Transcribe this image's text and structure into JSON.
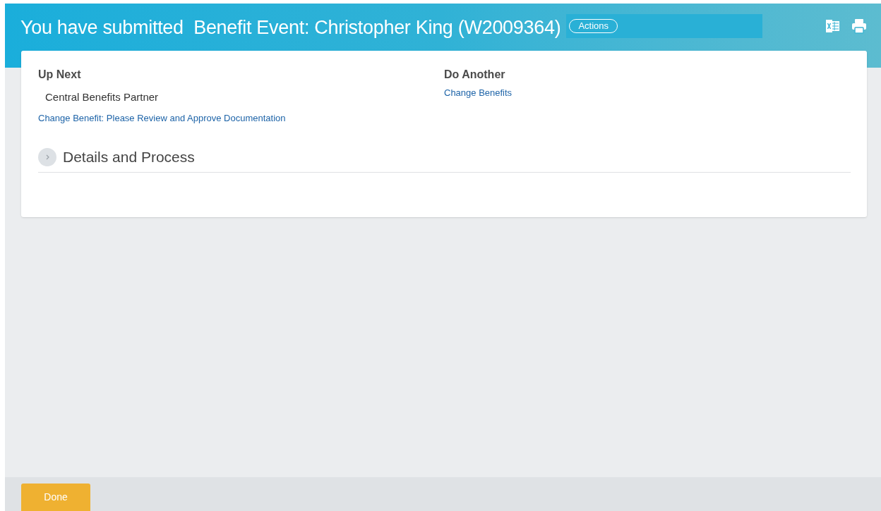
{
  "header": {
    "title": "You have submitted  Benefit Event: Christopher King (W2009364)",
    "actions_button": "Actions"
  },
  "up_next": {
    "heading": "Up Next",
    "assignee": "Central Benefits Partner",
    "task_link": "Change Benefit: Please Review and Approve Documentation"
  },
  "do_another": {
    "heading": "Do Another",
    "links": [
      "Change Benefits"
    ]
  },
  "details": {
    "label": "Details and Process",
    "expanded": false
  },
  "footer": {
    "buttons": [
      "Done"
    ]
  }
}
